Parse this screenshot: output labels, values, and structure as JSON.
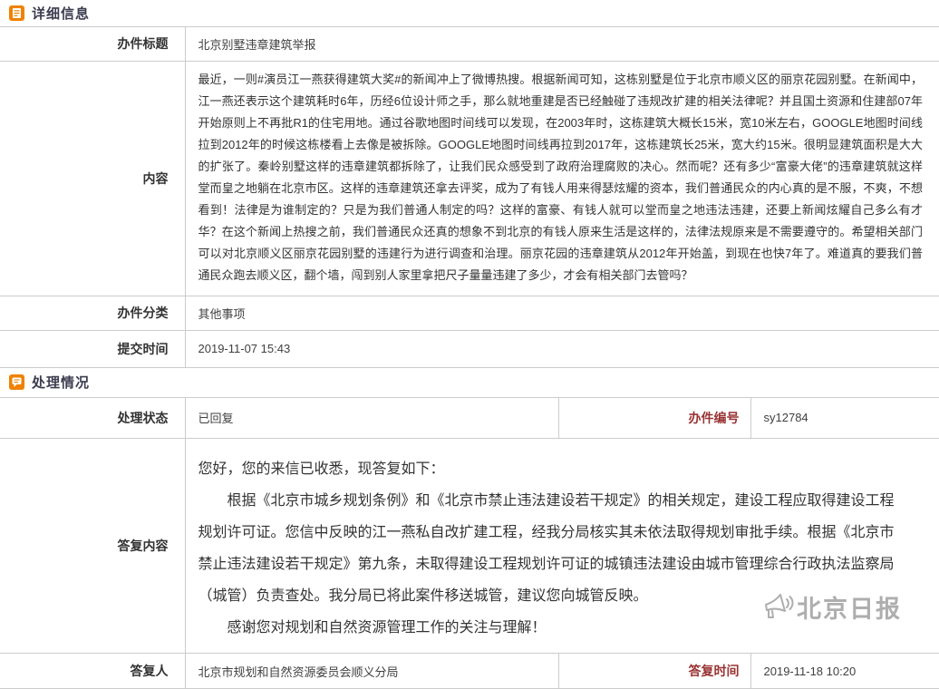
{
  "colors": {
    "accent_orange": "#ef8200",
    "label_red": "#993333",
    "heading_text": "#3c3c50",
    "border_gray": "#cccccc",
    "watermark_gray": "#9b9b9b"
  },
  "icons": {
    "detail_section": "document-icon",
    "process_section": "reply-bubble-icon",
    "watermark": "megaphone-icon"
  },
  "detail": {
    "title": "详细信息",
    "case_title_label": "办件标题",
    "case_title_value": "北京别墅违章建筑举报",
    "content_label": "内容",
    "content_value": "最近，一则#演员江一燕获得建筑大奖#的新闻冲上了微博热搜。根据新闻可知，这栋别墅是位于北京市顺义区的丽京花园别墅。在新闻中，江一燕还表示这个建筑耗时6年，历经6位设计师之手，那么就地重建是否已经触碰了违规改扩建的相关法律呢？并且国土资源和住建部07年开始原则上不再批R1的住宅用地。通过谷歌地图时间线可以发现，在2003年时，这栋建筑大概长15米，宽10米左右，GOOGLE地图时间线拉到2012年的时候这栋楼看上去像是被拆除。GOOGLE地图时间线再拉到2017年，这栋建筑长25米，宽大约15米。很明显建筑面积是大大的扩张了。秦岭别墅这样的违章建筑都拆除了，让我们民众感受到了政府治理腐败的决心。然而呢？还有多少“富豪大佬”的违章建筑就这样堂而皇之地躺在北京市区。这样的违章建筑还拿去评奖，成为了有钱人用来得瑟炫耀的资本，我们普通民众的内心真的是不服，不爽，不想看到！法律是为谁制定的？只是为我们普通人制定的吗？这样的富豪、有钱人就可以堂而皇之地违法违建，还要上新闻炫耀自己多么有才华？在这个新闻上热搜之前，我们普通民众还真的想象不到北京的有钱人原来生活是这样的，法律法规原来是不需要遵守的。希望相关部门可以对北京顺义区丽京花园别墅的违建行为进行调查和治理。丽京花园的违章建筑从2012年开始盖，到现在也快7年了。难道真的要我们普通民众跑去顺义区，翻个墙，闯到别人家里拿把尺子量量违建了多少，才会有相关部门去管吗？",
    "category_label": "办件分类",
    "category_value": "其他事项",
    "submit_time_label": "提交时间",
    "submit_time_value": "2019-11-07 15:43"
  },
  "process": {
    "title": "处理情况",
    "status_label": "处理状态",
    "status_value": "已回复",
    "case_no_label": "办件编号",
    "case_no_value": "sy12784",
    "reply_content_label": "答复内容",
    "reply_paragraphs": [
      "您好，您的来信已收悉，现答复如下：",
      "根据《北京市城乡规划条例》和《北京市禁止违法建设若干规定》的相关规定，建设工程应取得建设工程规划许可证。您信中反映的江一燕私自改扩建工程，经我分局核实其未依法取得规划审批手续。根据《北京市禁止违法建设若干规定》第九条，未取得建设工程规划许可证的城镇违法建设由城市管理综合行政执法监察局（城管）负责查处。我分局已将此案件移送城管，建议您向城管反映。",
      "感谢您对规划和自然资源管理工作的关注与理解！"
    ],
    "replier_label": "答复人",
    "replier_value": "北京市规划和自然资源委员会顺义分局",
    "reply_time_label": "答复时间",
    "reply_time_value": "2019-11-18 10:20"
  },
  "watermark": {
    "text": "北京日报"
  }
}
